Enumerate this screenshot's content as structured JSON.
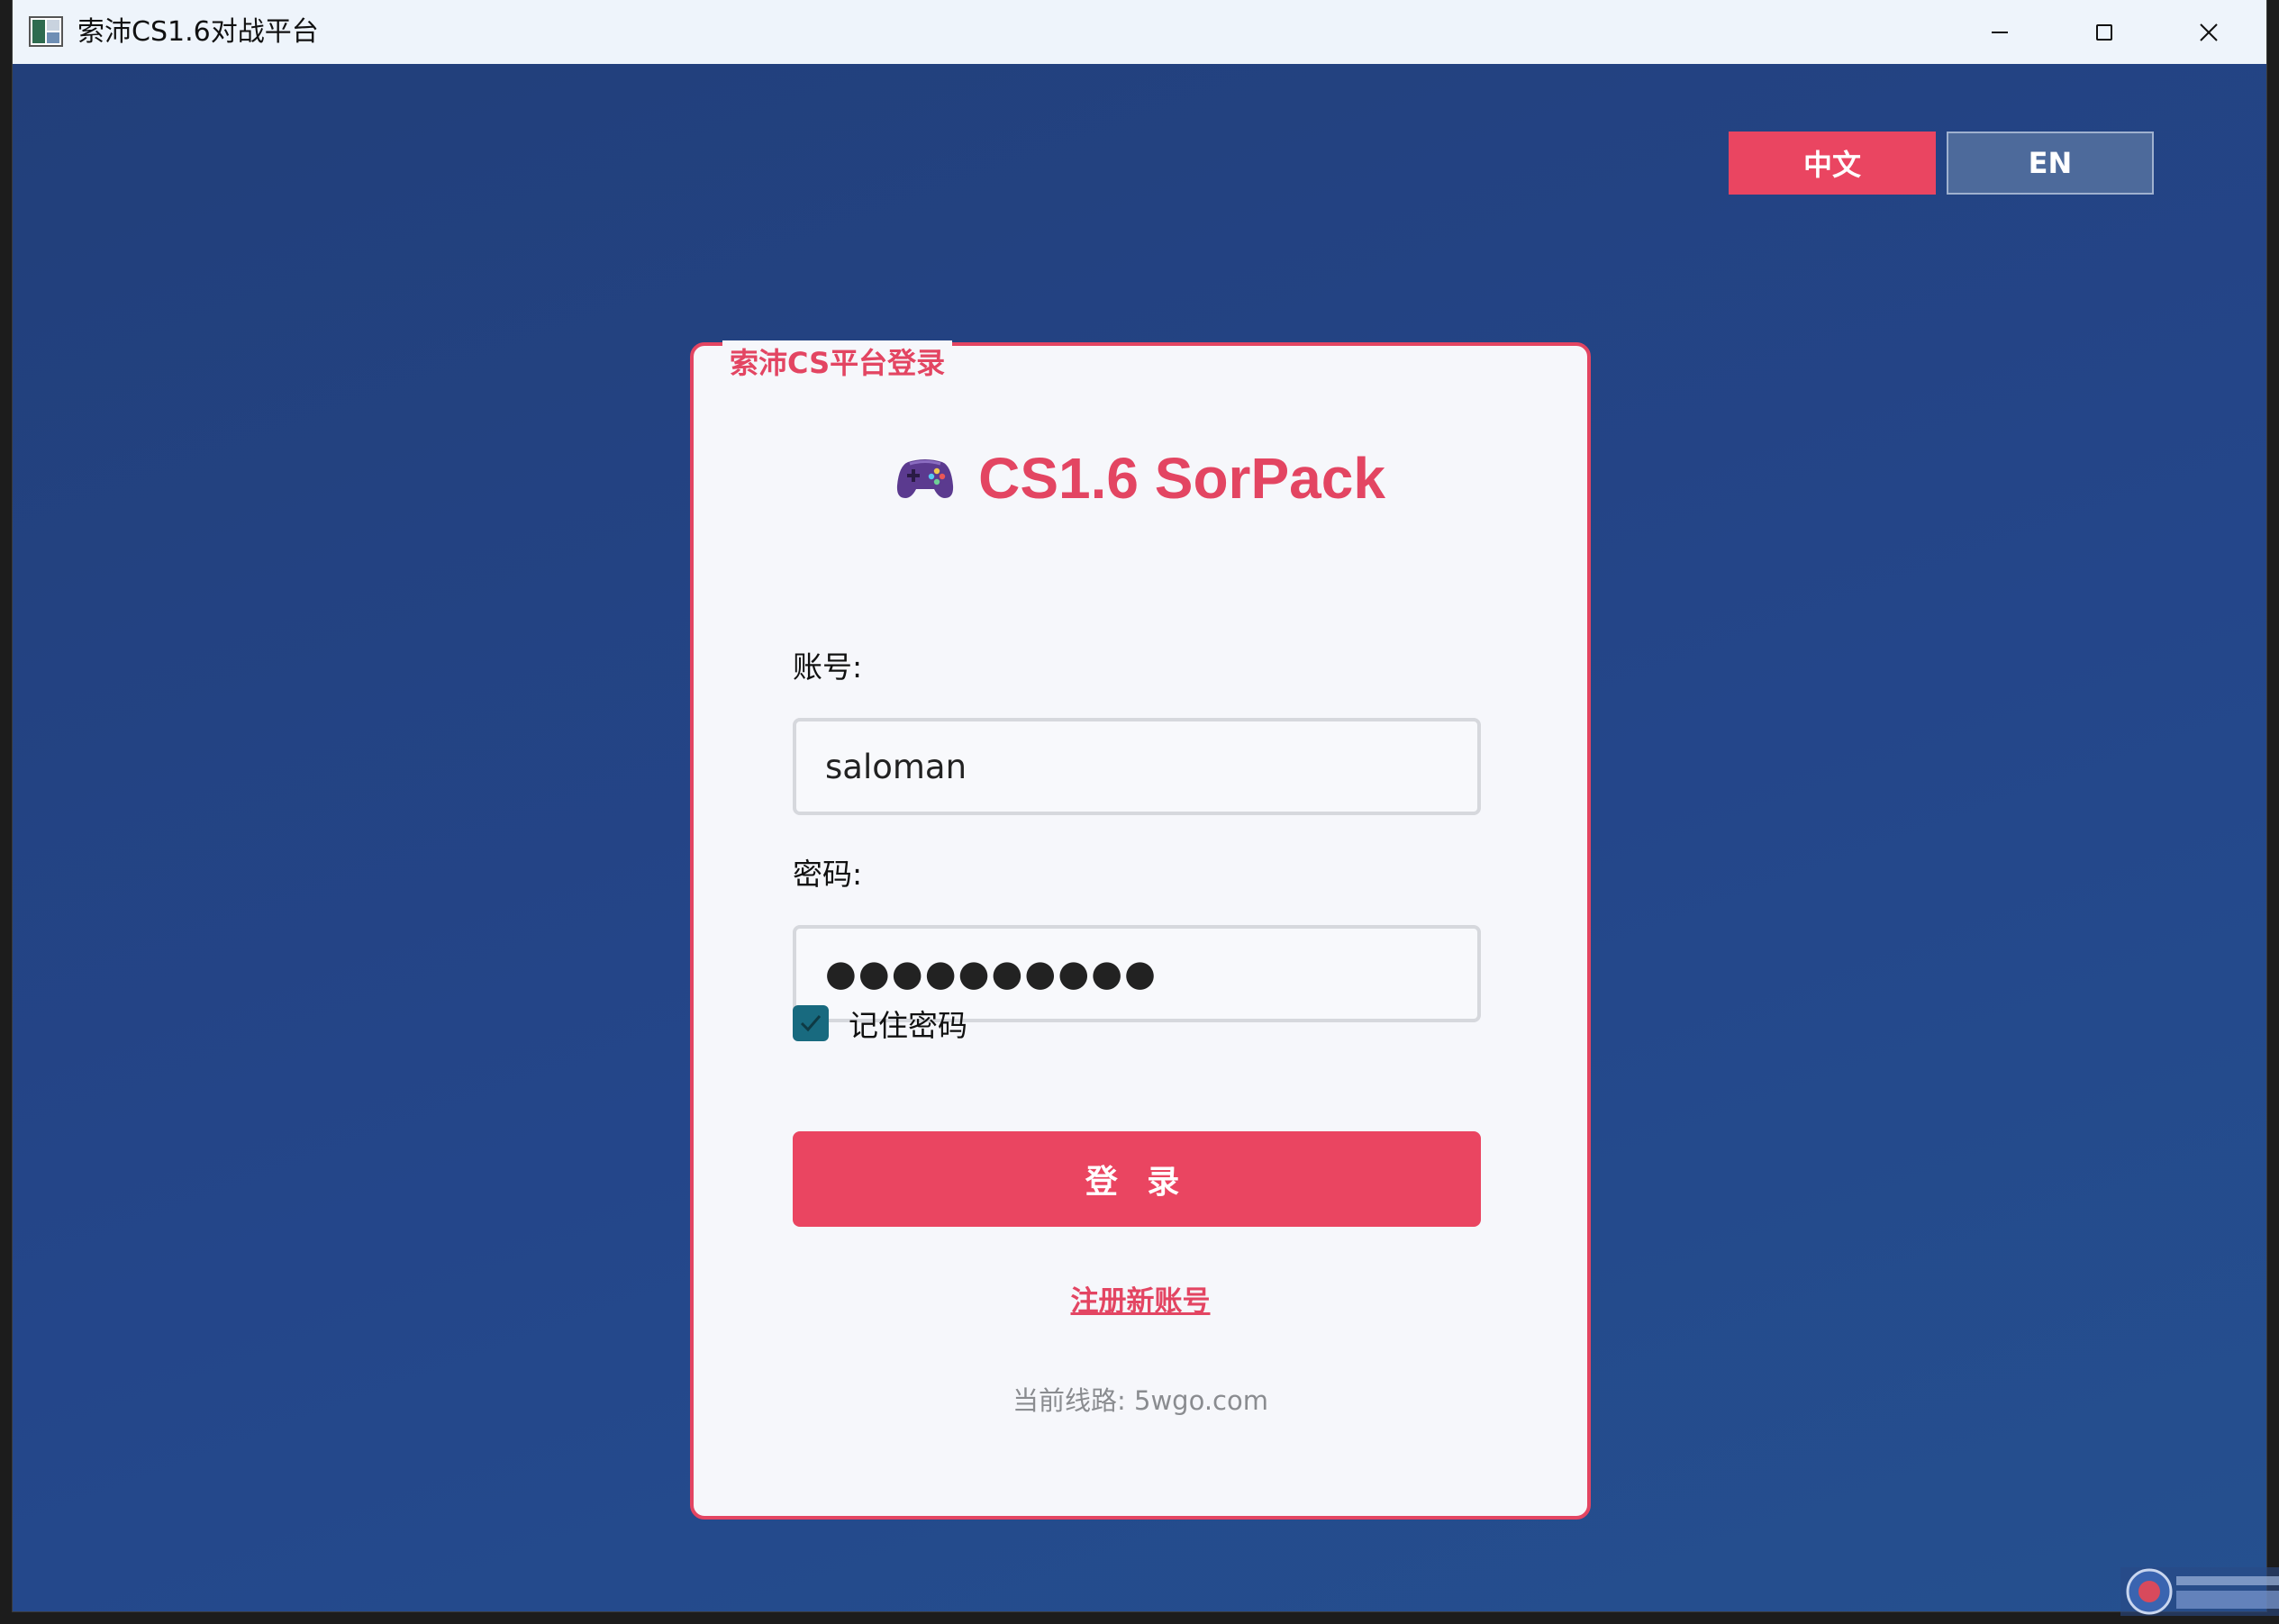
{
  "window": {
    "title": "索沛CS1.6对战平台"
  },
  "language": {
    "zh_label": "中文",
    "en_label": "EN"
  },
  "login": {
    "caption": "索沛CS平台登录",
    "brand_title": "CS1.6 SorPack",
    "brand_icon": "gamepad-icon",
    "account_label": "账号:",
    "account_value": "saloman",
    "password_label": "密码:",
    "password_value": "●●●●●●●●●●",
    "remember_label": "记住密码",
    "remember_checked": true,
    "login_button": "登 录",
    "register_link": "注册新账号",
    "route_text": "当前线路: 5wgo.com"
  },
  "colors": {
    "accent": "#ea4561",
    "background": "#223f78",
    "card": "#f6f7fb",
    "checkbox": "#186a7f"
  }
}
